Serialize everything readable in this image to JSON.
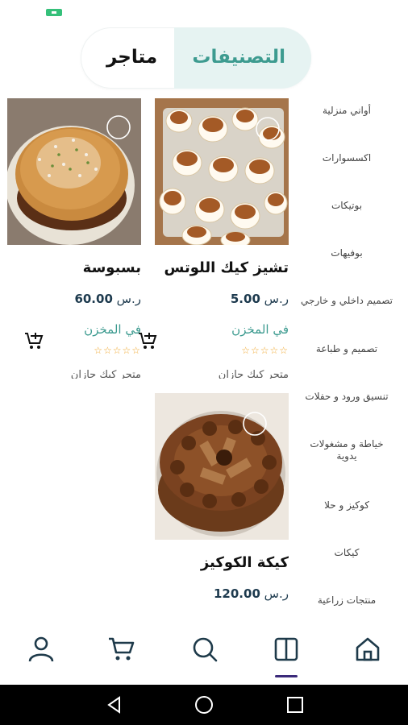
{
  "tabs": {
    "categories_label": "التصنيفات",
    "stores_label": "متاجر",
    "active": "categories"
  },
  "sidebar": {
    "items": [
      {
        "label": "أواني منزلية"
      },
      {
        "label": "اكسسوارات"
      },
      {
        "label": "بوتيكات"
      },
      {
        "label": "بوفيهات"
      },
      {
        "label": "تصميم داخلي و خارجي"
      },
      {
        "label": "تصميم و طباعة"
      },
      {
        "label": "تنسيق ورود و حفلات"
      },
      {
        "label": "خياطة و مشغولات يدوية"
      },
      {
        "label": "كوكيز و حلا"
      },
      {
        "label": "كيكات"
      },
      {
        "label": "منتجات زراعية"
      }
    ]
  },
  "products": [
    {
      "title": "تشيز كيك اللوتس",
      "price": "5.00",
      "currency": "ر.س",
      "stock": "في المخزن",
      "rating": "☆☆☆☆☆",
      "store": "متجر كيك جازان"
    },
    {
      "title": "بسبوسة",
      "price": "60.00",
      "currency": "ر.س",
      "stock": "في المخزن",
      "rating": "☆☆☆☆☆",
      "store": "متجر كيك جازان"
    },
    {
      "title": "كيكة الكوكيز",
      "price": "120.00",
      "currency": "ر.س"
    }
  ],
  "bottom_nav": {
    "items": [
      "home-icon",
      "categories-icon",
      "search-icon",
      "cart-icon",
      "profile-icon"
    ],
    "active": "categories-icon"
  },
  "colors": {
    "accent": "#3d9b90",
    "tab_active_bg": "#e6f3f2",
    "price": "#1d3a4e",
    "star": "#f0a830",
    "nav_indicator": "#3b2a7a"
  }
}
